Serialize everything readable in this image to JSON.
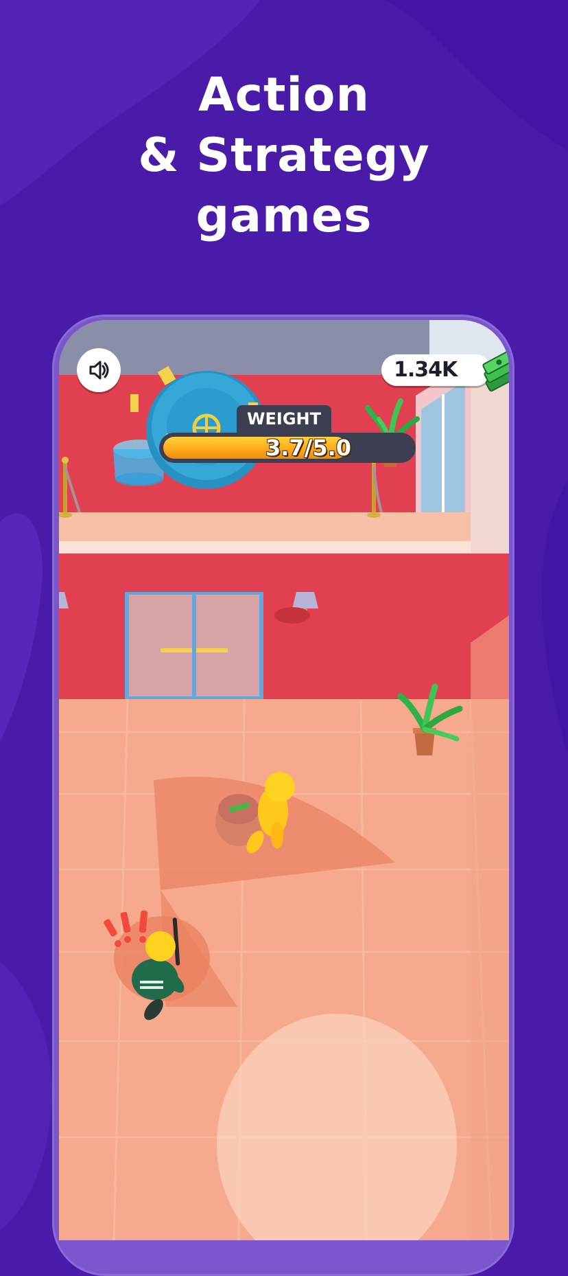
{
  "headline": {
    "line1": "Action",
    "line2": "& Strategy",
    "line3": "games"
  },
  "hud": {
    "sound_icon": "speaker-icon",
    "cash": {
      "value": "1.34K",
      "icon": "cash-stack-icon"
    },
    "weight": {
      "label": "WEIGHT",
      "text": "3.7/5.0",
      "current": 3.7,
      "max": 5.0
    }
  },
  "alert": {
    "symbol": "!!!"
  },
  "colors": {
    "background": "#4a1aa8",
    "wall": "#e0404f",
    "floor": "#f6a98c",
    "vault": "#35a8d8",
    "player": "#ffd21f",
    "guard_uniform": "#1f6b4a",
    "bar_fill": "#ffb21f"
  }
}
